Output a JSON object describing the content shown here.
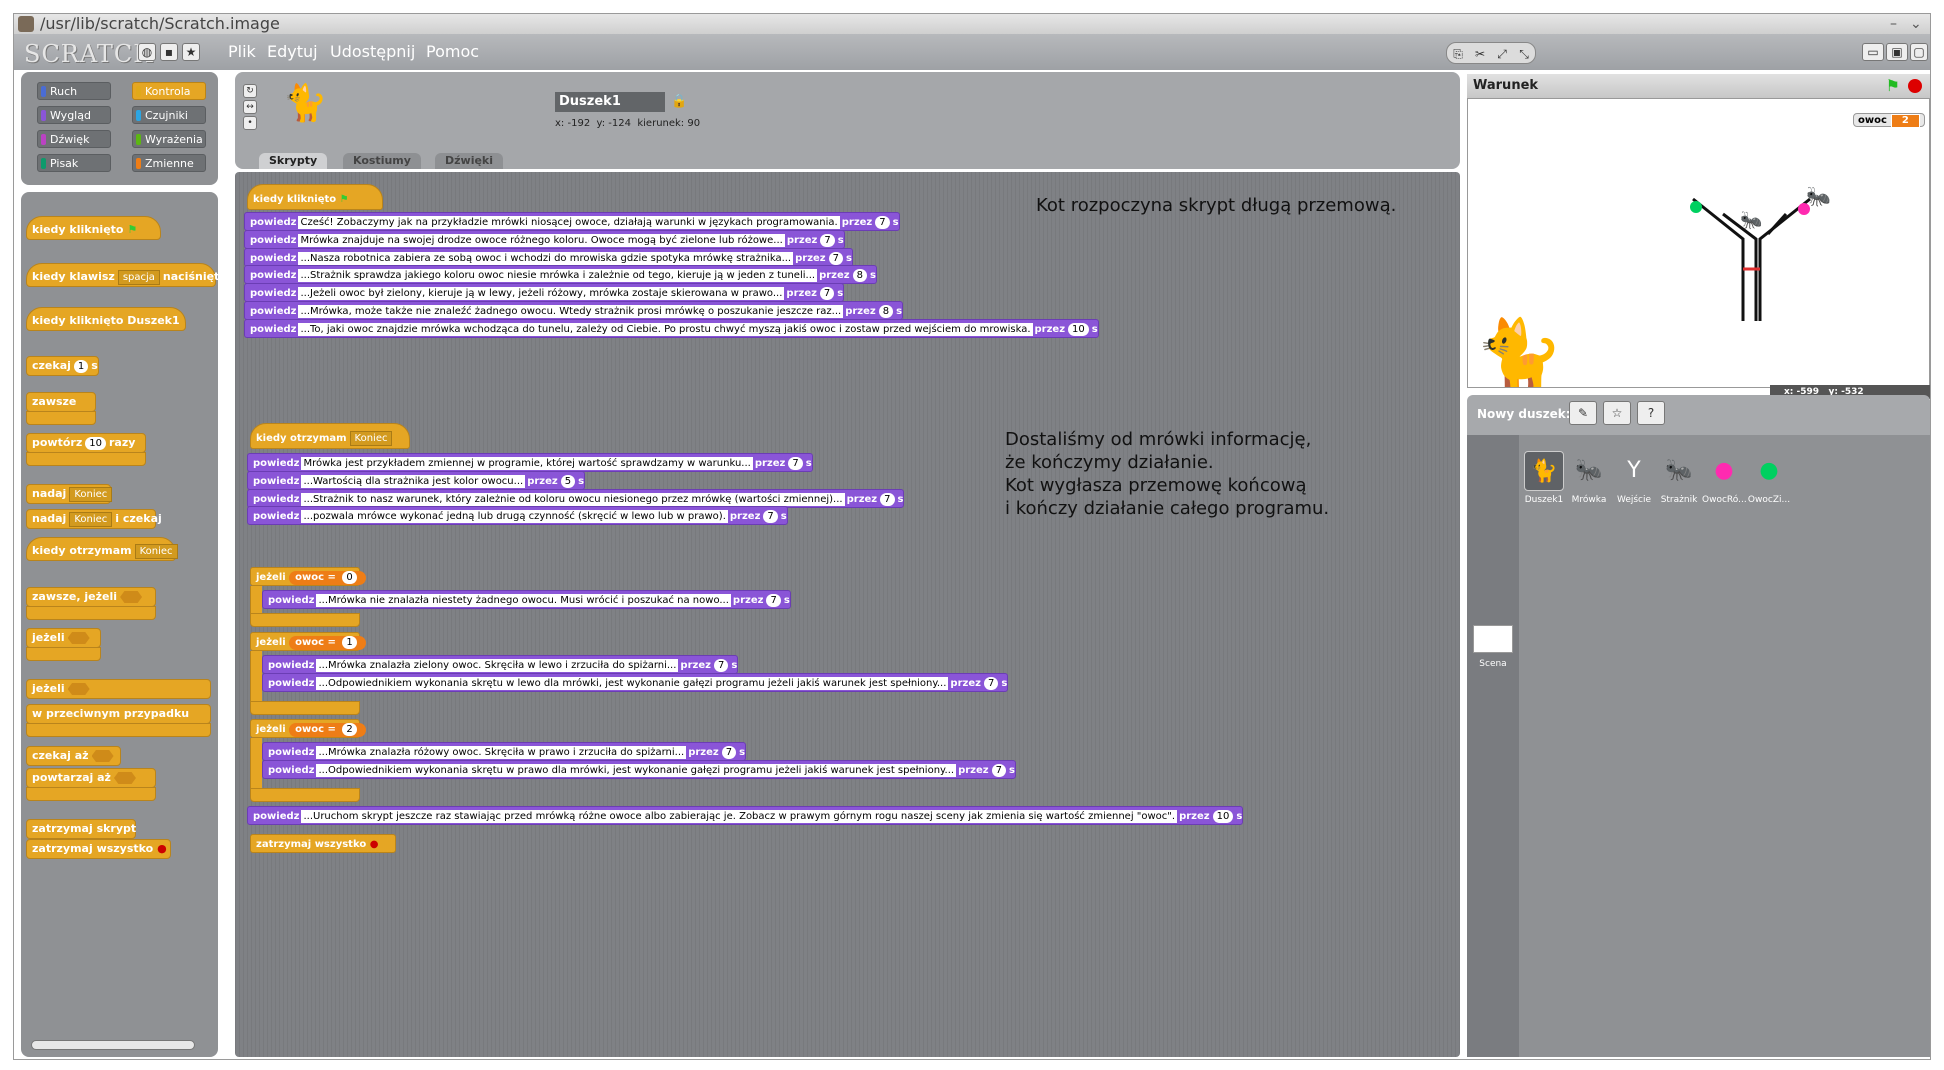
{
  "window": {
    "title": "/usr/lib/scratch/Scratch.image"
  },
  "menu": {
    "logo": "SCRATCH",
    "items": [
      "Plik",
      "Edytuj",
      "Udostępnij",
      "Pomoc"
    ]
  },
  "categories": [
    {
      "label": "Ruch",
      "color": "#4a6cd4"
    },
    {
      "label": "Kontrola",
      "color": "#e1a91a",
      "selected": true
    },
    {
      "label": "Wygląd",
      "color": "#8a55d7"
    },
    {
      "label": "Czujniki",
      "color": "#2ca5e2"
    },
    {
      "label": "Dźwięk",
      "color": "#bb42c3"
    },
    {
      "label": "Wyrażenia",
      "color": "#5cb712"
    },
    {
      "label": "Pisak",
      "color": "#0e9a6c"
    },
    {
      "label": "Zmienne",
      "color": "#ee7d16"
    }
  ],
  "palette": {
    "when_flag": "kiedy kliknięto",
    "when_key": "kiedy klawisz",
    "key_value": "spacja",
    "key_suffix": "naciśnięty",
    "when_sprite_clicked": "kiedy kliknięto Duszek1",
    "wait": "czekaj",
    "wait_value": "1",
    "wait_unit": "s",
    "forever": "zawsze",
    "repeat": "powtórz",
    "repeat_value": "10",
    "repeat_unit": "razy",
    "broadcast": "nadaj",
    "broadcast_value": "Koniec",
    "broadcast_wait": "nadaj",
    "broadcast_wait_value": "Koniec",
    "broadcast_wait_suffix": "i czekaj",
    "when_receive": "kiedy otrzymam",
    "when_receive_value": "Koniec",
    "forever_if": "zawsze, jeżeli",
    "if": "jeżeli",
    "if_else": "jeżeli",
    "else": "w przeciwnym przypadku",
    "wait_until": "czekaj aż",
    "repeat_until": "powtarzaj aż",
    "stop_script": "zatrzymaj skrypt",
    "stop_all": "zatrzymaj wszystko"
  },
  "sprite": {
    "name": "Duszek1",
    "x_label": "x:",
    "x": "-192",
    "y_label": "y:",
    "y": "-124",
    "dir_label": "kierunek:",
    "direction": "90",
    "tabs": [
      "Skrypty",
      "Kostiumy",
      "Dźwięki"
    ]
  },
  "script1": {
    "hat": "kiedy kliknięto",
    "say_label": "powiedz",
    "for_label": "przez",
    "unit": "s",
    "lines": [
      {
        "text": "Cześć! Zobaczymy jak na przykładzie mrówki niosącej owoce, działają warunki w językach programowania.",
        "secs": "7"
      },
      {
        "text": "Mrówka znajduje na swojej drodze owoce różnego koloru. Owoce mogą być zielone lub różowe...",
        "secs": "7"
      },
      {
        "text": "...Nasza robotnica zabiera ze sobą owoc i wchodzi do mrowiska gdzie spotyka mrówkę strażnika...",
        "secs": "7"
      },
      {
        "text": "...Strażnik sprawdza jakiego koloru owoc niesie mrówka i zależnie od tego, kieruje ją w jeden z tuneli...",
        "secs": "8"
      },
      {
        "text": "...Jeżeli owoc był zielony, kieruje ją w lewy, jeżeli różowy, mrówka zostaje skierowana w prawo...",
        "secs": "7"
      },
      {
        "text": "...Mrówka, może także nie znaleźć żadnego owocu. Wtedy strażnik prosi mrówkę o poszukanie jeszcze raz...",
        "secs": "8"
      },
      {
        "text": "...To, jaki owoc znajdzie mrówka wchodząca do tunelu, zależy od Ciebie. Po prostu chwyć myszą jakiś owoc i zostaw przed wejściem do mrowiska.",
        "secs": "10"
      }
    ]
  },
  "script2": {
    "hat": "kiedy otrzymam",
    "hat_value": "Koniec",
    "lines": [
      {
        "text": "Mrówka jest przykładem zmiennej w programie, której wartość sprawdzamy w warunku...",
        "secs": "7"
      },
      {
        "text": "...Wartością dla strażnika jest kolor owocu...",
        "secs": "5"
      },
      {
        "text": "...Strażnik to nasz warunek, który zależnie od koloru owocu niesionego przez mrówkę (wartości zmiennej)...",
        "secs": "7"
      },
      {
        "text": "...pozwala mrówce wykonać jedną lub drugą czynność (skręcić w lewo lub w prawo).",
        "secs": "7"
      }
    ],
    "if_label": "jeżeli",
    "var_name": "owoc",
    "eq": "=",
    "if0": {
      "value": "0",
      "lines": [
        {
          "text": "...Mrówka nie znalazła niestety żadnego owocu. Musi wrócić i poszukać na nowo...",
          "secs": "7"
        }
      ]
    },
    "if1": {
      "value": "1",
      "lines": [
        {
          "text": "...Mrówka znalazła zielony owoc. Skręciła w lewo i zrzuciła do spiżarni...",
          "secs": "7"
        },
        {
          "text": "...Odpowiednikiem wykonania skrętu w lewo dla mrówki, jest wykonanie gałęzi programu jeżeli jakiś warunek jest spełniony...",
          "secs": "7"
        }
      ]
    },
    "if2": {
      "value": "2",
      "lines": [
        {
          "text": "...Mrówka znalazła różowy owoc. Skręciła w prawo i zrzuciła do spiżarni...",
          "secs": "7"
        },
        {
          "text": "...Odpowiednikiem wykonania skrętu w prawo dla mrówki, jest wykonanie gałęzi programu jeżeli jakiś warunek jest spełniony...",
          "secs": "7"
        }
      ]
    },
    "last": {
      "text": "...Uruchom skrypt jeszcze raz stawiając przed mrówką różne owoce albo zabierając je. Zobacz w prawym górnym rogu naszej sceny jak zmienia się wartość zmiennej \"owoc\".",
      "secs": "10"
    },
    "stop": "zatrzymaj wszystko"
  },
  "notes": {
    "note1": "Kot rozpoczyna skrypt długą przemową.",
    "note2_l1": "Dostaliśmy od mrówki informację,",
    "note2_l2": "że kończymy działanie.",
    "note2_l3": "Kot wygłasza przemowę końcową",
    "note2_l4": "i kończy działanie całego programu."
  },
  "stage": {
    "title": "Warunek",
    "watcher_label": "owoc",
    "watcher_value": "2",
    "mouse_x_label": "x:",
    "mouse_x": "-599",
    "mouse_y_label": "y:",
    "mouse_y": "-532"
  },
  "sprites_panel": {
    "new_label": "Nowy duszek:",
    "sprites": [
      {
        "name": "Duszek1",
        "icon": "cat-icon",
        "selected": true
      },
      {
        "name": "Mrówka",
        "icon": "ant-icon"
      },
      {
        "name": "Wejście",
        "icon": "tunnel-icon"
      },
      {
        "name": "Strażnik",
        "icon": "ant-guard-icon"
      },
      {
        "name": "OwocRó...",
        "icon": "pink-fruit-icon"
      },
      {
        "name": "OwocZi...",
        "icon": "green-fruit-icon"
      }
    ],
    "stage_label": "Scena"
  }
}
